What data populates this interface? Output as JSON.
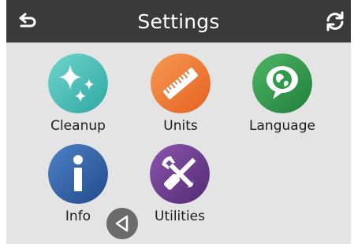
{
  "header": {
    "title": "Settings",
    "back_icon": "return-arrow-icon",
    "refresh_icon": "refresh-icon",
    "background_color": "#3a3a3a"
  },
  "tiles": [
    {
      "label": "Cleanup",
      "icon": "sparkle-icon",
      "color": "#48c2bb"
    },
    {
      "label": "Units",
      "icon": "ruler-icon",
      "color": "#f07a2e"
    },
    {
      "label": "Language",
      "icon": "globe-speech-bubble-icon",
      "color": "#2f9a4a"
    },
    {
      "label": "Info",
      "icon": "info-icon",
      "color": "#2f5fa7"
    },
    {
      "label": "Utilities",
      "icon": "wrench-screwdriver-icon",
      "color": "#6b3a8c"
    }
  ],
  "nav": {
    "back_icon": "triangle-left-icon"
  }
}
